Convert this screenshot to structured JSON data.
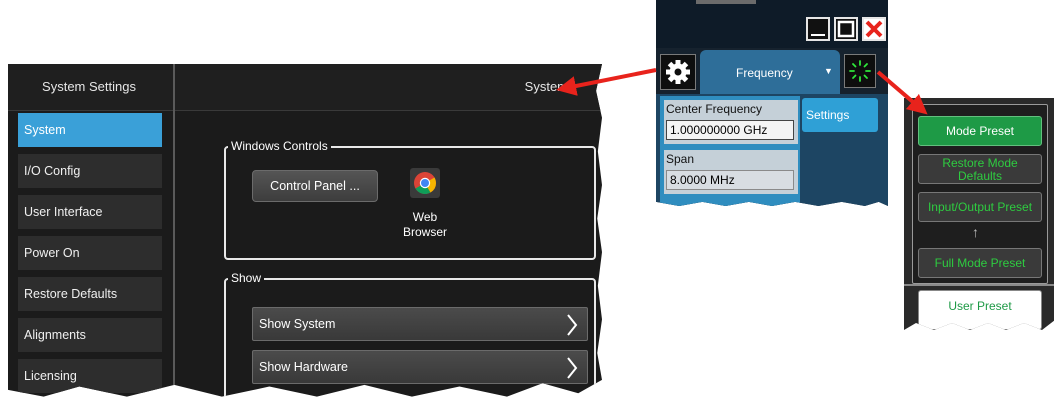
{
  "system_settings": {
    "header_title": "System Settings",
    "page_title": "System",
    "nav_items": [
      {
        "label": "System",
        "active": true
      },
      {
        "label": "I/O Config",
        "active": false
      },
      {
        "label": "User Interface",
        "active": false
      },
      {
        "label": "Power On",
        "active": false
      },
      {
        "label": "Restore Defaults",
        "active": false
      },
      {
        "label": "Alignments",
        "active": false
      },
      {
        "label": "Licensing",
        "active": false
      }
    ],
    "windows_controls": {
      "legend": "Windows Controls",
      "control_panel_label": "Control Panel ...",
      "web_browser_label_line1": "Web",
      "web_browser_label_line2": "Browser"
    },
    "show": {
      "legend": "Show",
      "items": [
        "Show System",
        "Show Hardware"
      ]
    }
  },
  "frequency_panel": {
    "tab_label": "Frequency",
    "tab_arrow": "▼",
    "settings_label": "Settings",
    "center_frequency": {
      "label": "Center Frequency",
      "value": "1.000000000 GHz"
    },
    "span": {
      "label": "Span",
      "value": "8.0000 MHz"
    }
  },
  "preset_panel": {
    "buttons": [
      {
        "label": "Mode Preset",
        "primary": true
      },
      {
        "label": "Restore Mode Defaults",
        "primary": false
      },
      {
        "label": "Input/Output Preset",
        "primary": false
      },
      {
        "label": "Full Mode Preset",
        "primary": false
      }
    ],
    "up_arrow": "↑",
    "user_preset_label": "User Preset"
  },
  "colors": {
    "accent_blue": "#3aa0d8",
    "arrow_red": "#e8231c",
    "preset_green": "#1e9a46",
    "preset_text_green": "#2ecc40"
  },
  "icons": [
    "chrome-icon",
    "chevron-right-icon",
    "gear-icon",
    "minimize-icon",
    "maximize-icon",
    "close-icon",
    "spark-icon",
    "red-arrow-icon"
  ]
}
